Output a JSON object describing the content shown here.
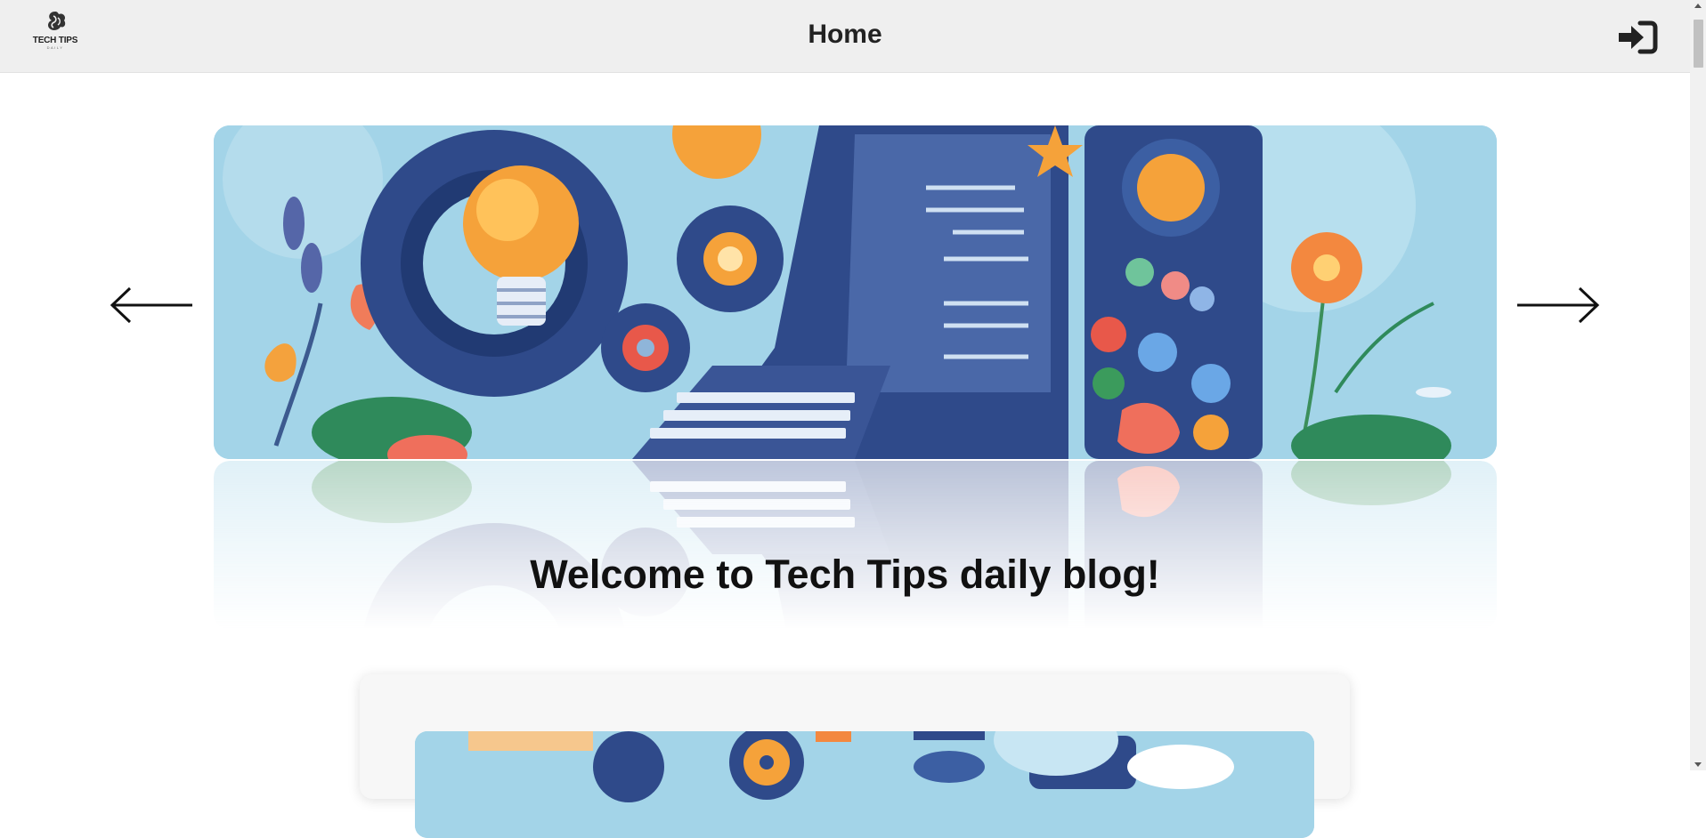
{
  "header": {
    "logo_text": "TECH TIPS",
    "logo_sub": "DAILY",
    "title": "Home",
    "login_icon": "sign-in-icon"
  },
  "carousel": {
    "prev_icon": "arrow-left-icon",
    "next_icon": "arrow-right-icon",
    "image_label": "hero-illustration"
  },
  "welcome": {
    "heading": "Welcome to Tech Tips daily blog!"
  },
  "card": {
    "image_label": "post-thumbnail"
  },
  "colors": {
    "header_bg": "#efefef",
    "hero_sky": "#9fd3e6",
    "navy": "#2f4a8a",
    "orange": "#f5a23a"
  }
}
